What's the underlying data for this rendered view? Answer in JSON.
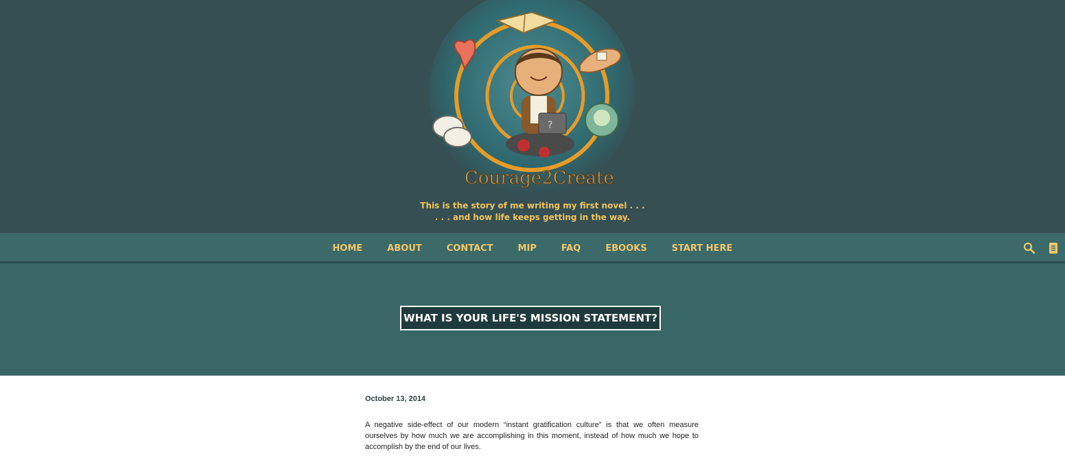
{
  "site": {
    "logo_text": "Courage2Create",
    "tagline_line1": "This is the story of me writing my first novel . . .",
    "tagline_line2": ". . . and how life keeps getting in the way."
  },
  "nav": {
    "items": [
      "HOME",
      "ABOUT",
      "CONTACT",
      "MIP",
      "FAQ",
      "EBOOKS",
      "START HERE"
    ],
    "icons": [
      "search-icon",
      "book-icon"
    ]
  },
  "post": {
    "title": "WHAT IS YOUR LIFE'S MISSION STATEMENT?",
    "date": "October 13, 2014",
    "paragraph": "A negative side-effect of our modern “instant gratification culture” is that we often measure ourselves by how much we are accomplishing in this moment, instead of how much we hope to accomplish by the end of our lives."
  },
  "colors": {
    "header_bg": "#354f53",
    "nav_bg": "#3b6a69",
    "hero_bg": "#396766",
    "accent": "#f3c76a"
  }
}
